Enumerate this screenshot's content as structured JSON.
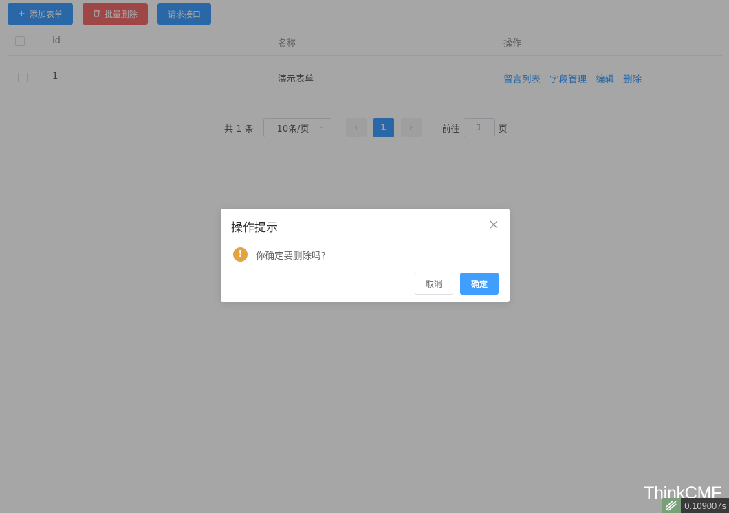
{
  "toolbar": {
    "add_label": "添加表单",
    "batch_delete_label": "批量删除",
    "request_api_label": "请求接口"
  },
  "table": {
    "headers": {
      "id": "id",
      "name": "名称",
      "op": "操作"
    },
    "rows": [
      {
        "id": "1",
        "name": "演示表单",
        "actions": [
          "留言列表",
          "字段管理",
          "编辑",
          "删除"
        ]
      }
    ]
  },
  "pagination": {
    "total_text": "共 1 条",
    "page_size": "10条/页",
    "current_page": "1",
    "goto_prefix": "前往",
    "goto_value": "1",
    "goto_suffix": "页"
  },
  "dialog": {
    "title": "操作提示",
    "message": "你确定要删除吗?",
    "cancel_label": "取消",
    "confirm_label": "确定"
  },
  "footer": {
    "brand": "ThinkCMF",
    "timer": "0.109007s"
  },
  "colors": {
    "primary": "#409eff",
    "danger": "#f56c6c",
    "warning": "#e6a23c"
  }
}
